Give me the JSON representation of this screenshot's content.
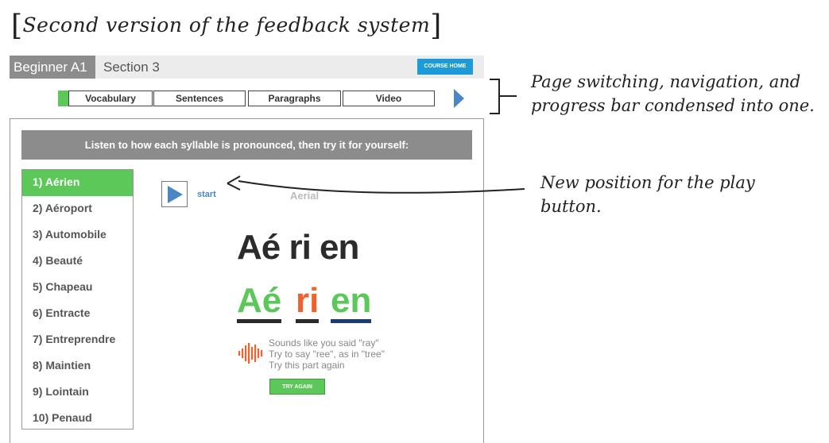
{
  "title": {
    "open_bracket": "[",
    "text": "Second version of the feedback system",
    "close_bracket": "]"
  },
  "topbar": {
    "level": "Beginner A1",
    "section": "Section 3",
    "course_home": "COURSE HOME"
  },
  "tabs": [
    {
      "label": "Vocabulary",
      "done": true
    },
    {
      "label": "Sentences",
      "done": false
    },
    {
      "label": "Paragraphs",
      "done": false
    },
    {
      "label": "Video",
      "done": false
    }
  ],
  "instruction": "Listen to how each syllable is pronounced, then try it for yourself:",
  "words": [
    {
      "label": "1) Aérien",
      "active": true
    },
    {
      "label": "2) Aéroport",
      "active": false
    },
    {
      "label": "3) Automobile",
      "active": false
    },
    {
      "label": "4) Beauté",
      "active": false
    },
    {
      "label": "5) Chapeau",
      "active": false
    },
    {
      "label": "6) Entracte",
      "active": false
    },
    {
      "label": "7) Entreprendre",
      "active": false
    },
    {
      "label": "8) Maintien",
      "active": false
    },
    {
      "label": "9) Lointain",
      "active": false
    },
    {
      "label": "10) Penaud",
      "active": false
    }
  ],
  "player": {
    "start": "start",
    "translation": "Aerial"
  },
  "syllables_text": "Aé ri en",
  "graded": [
    {
      "text": "Aé",
      "color": "#5cc85a",
      "underline": "#2b2b2b"
    },
    {
      "text": "ri",
      "color": "#f0622d",
      "underline": "#2b2b2b"
    },
    {
      "text": "en",
      "color": "#5cc85a",
      "underline": "#1e3a6e"
    }
  ],
  "feedback": {
    "line1": "Sounds like you said \"ray\"",
    "line2": "Try to say \"ree\", as in \"tree\"",
    "line3": "Try this part again",
    "try_again": "TRY AGAIN",
    "wave_color": "#f0622d"
  },
  "annotations": {
    "note1": "Page switching, navigation, and progress bar condensed into one.",
    "note2": "New position for the play button."
  },
  "colors": {
    "accent_green": "#5cc85a",
    "accent_blue": "#4a87c8",
    "header_gray": "#8c8c8c",
    "course_home_blue": "#1d9bd8"
  }
}
